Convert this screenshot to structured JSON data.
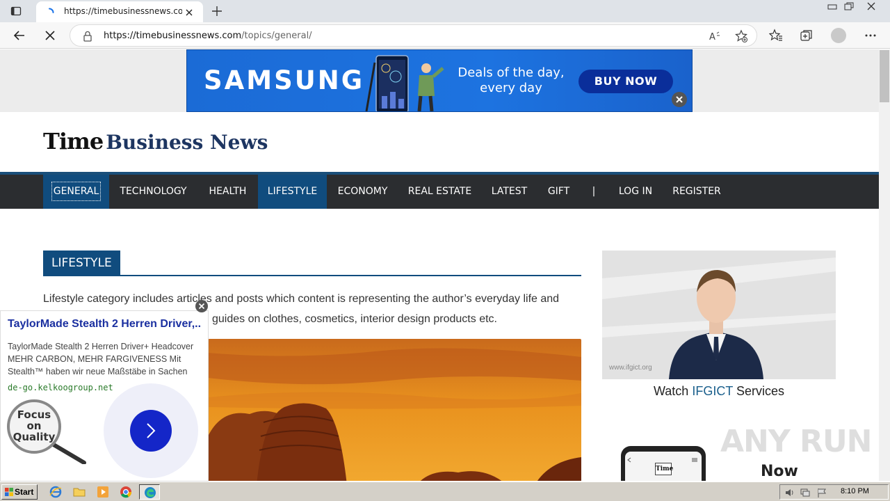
{
  "browser": {
    "tab_title": "https://timebusinessnews.com/",
    "url_host": "https://timebusinessnews.com",
    "url_path": "/topics/general/"
  },
  "ads": {
    "samsung_brand": "SAMSUNG",
    "samsung_slogan_1": "Deals of the day,",
    "samsung_slogan_2": "every day",
    "samsung_cta": "BUY NOW",
    "popup_title": "TaylorMade Stealth 2 Herren Driver,..",
    "popup_line_1": "TaylorMade Stealth 2 Herren Driver+ Headcover",
    "popup_line_2": "MEHR CARBON, MEHR FARGIVENESS Mit",
    "popup_line_3": "Stealth™ haben wir neue Maßstäbe in Sachen",
    "popup_url": "de-go.kelkoogroup.net",
    "popup_lens_1": "Focus",
    "popup_lens_2": "on",
    "popup_lens_3": "Quality"
  },
  "site": {
    "logo_time": "Time",
    "logo_business": "Business News",
    "nav": [
      "GENERAL",
      "TECHNOLOGY",
      "HEALTH",
      "LIFESTYLE",
      "ECONOMY",
      "REAL ESTATE",
      "LATEST",
      "GIFT",
      "|",
      "LOG IN",
      "REGISTER"
    ]
  },
  "main": {
    "section_title": "LIFESTYLE",
    "description_line_1": "Lifestyle category includes articles and posts which content is representing the author’s everyday life and",
    "description_line_2": "guides on clothes, cosmetics, interior design products etc."
  },
  "sidebar": {
    "video_watermark": "www.ifgict.org",
    "caption_pre": "Watch ",
    "caption_brand": "IFGICT",
    "caption_post": " Services",
    "phone_label": "Time",
    "now_text": "Now",
    "watermark": "ANY RUN"
  },
  "taskbar": {
    "start_label": "Start",
    "clock": "8:10 PM"
  },
  "colors": {
    "nav_bg": "#2b2d30",
    "brand_blue": "#104c7e",
    "logo_blue": "#1d3561",
    "samsung_blue": "#1d73e0",
    "popup_button": "#1426c8"
  }
}
